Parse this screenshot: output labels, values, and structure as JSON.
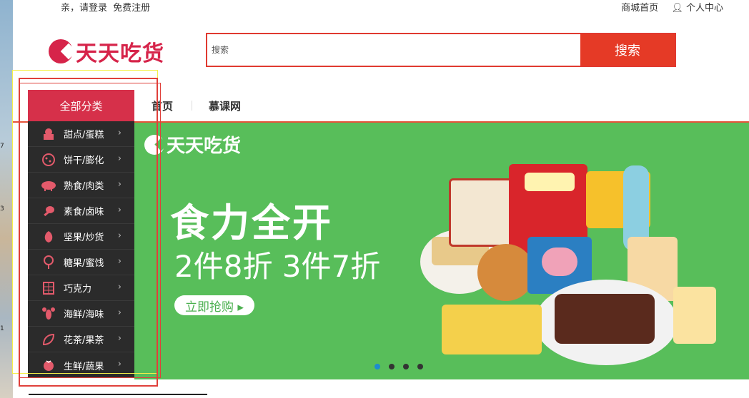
{
  "topbar": {
    "greeting": "亲，请登录",
    "register": "免费注册",
    "home": "商城首页",
    "user_center": "个人中心"
  },
  "brand": {
    "name": "天天吃货",
    "color": "#d6244a"
  },
  "search": {
    "placeholder": "搜索",
    "button": "搜索",
    "accent": "#e53a26"
  },
  "nav": {
    "all_categories": "全部分类",
    "links": [
      "首页",
      "慕课网"
    ]
  },
  "categories": [
    {
      "label": "甜点/蛋糕",
      "icon": "cake-icon"
    },
    {
      "label": "饼干/膨化",
      "icon": "cookie-icon"
    },
    {
      "label": "熟食/肉类",
      "icon": "pig-icon"
    },
    {
      "label": "素食/卤味",
      "icon": "drumstick-icon"
    },
    {
      "label": "坚果/炒货",
      "icon": "nut-icon"
    },
    {
      "label": "糖果/蜜饯",
      "icon": "lollipop-icon"
    },
    {
      "label": "巧克力",
      "icon": "chocolate-icon"
    },
    {
      "label": "海鲜/海味",
      "icon": "lobster-icon"
    },
    {
      "label": "花茶/果茶",
      "icon": "leaf-icon"
    },
    {
      "label": "生鲜/蔬果",
      "icon": "tomato-icon"
    }
  ],
  "banner": {
    "logo": "天天吃货",
    "headline": "食力全开",
    "subline": "2件8折 3件7折",
    "cta": "立即抢购 ▸",
    "bg": "#58be5a",
    "slides": 4,
    "active_slide": 1
  },
  "colors": {
    "category_bg": "#2b2b2b",
    "all_cat_bg": "#d6304a"
  }
}
